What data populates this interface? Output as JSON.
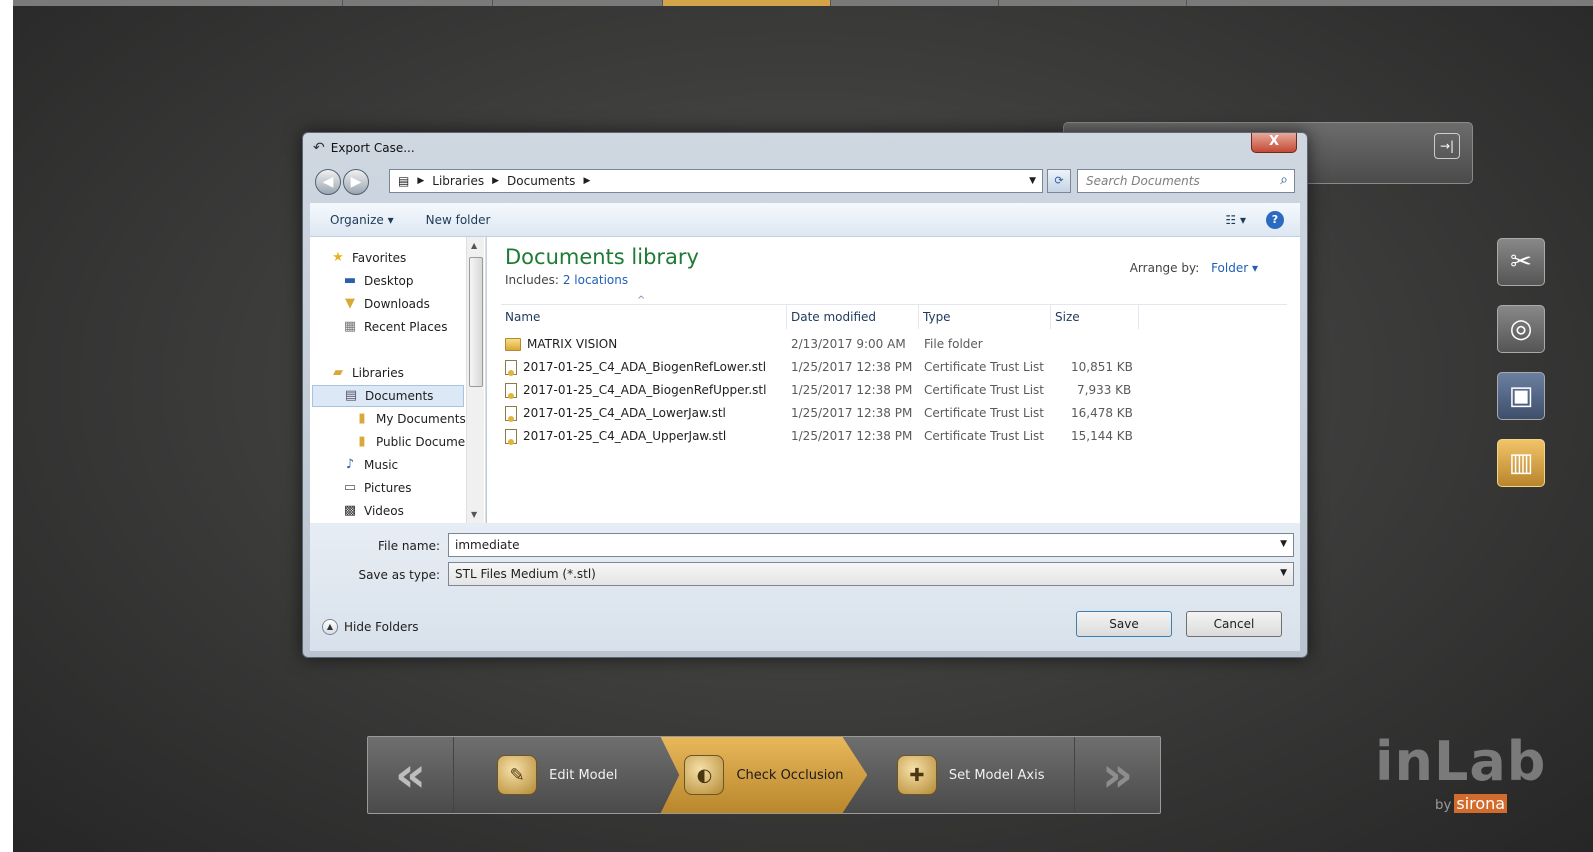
{
  "dialog": {
    "title": "Export Case...",
    "close_label": "X",
    "breadcrumb": [
      "Libraries",
      "Documents"
    ],
    "search_placeholder": "Search Documents",
    "toolbar": {
      "organize": "Organize ▾",
      "new_folder": "New folder"
    },
    "nav": {
      "favorites": "Favorites",
      "desktop": "Desktop",
      "downloads": "Downloads",
      "recent_places": "Recent Places",
      "libraries": "Libraries",
      "documents": "Documents",
      "my_documents": "My Documents",
      "public_documents": "Public Docume",
      "music": "Music",
      "pictures": "Pictures",
      "videos": "Videos"
    },
    "library": {
      "title": "Documents library",
      "includes_label": "Includes:",
      "includes_link": "2 locations",
      "arrange_label": "Arrange by:",
      "arrange_value": "Folder ▾"
    },
    "columns": {
      "name": "Name",
      "date": "Date modified",
      "type": "Type",
      "size": "Size"
    },
    "files": [
      {
        "name": "MATRIX VISION",
        "date": "2/13/2017 9:00 AM",
        "type": "File folder",
        "size": ""
      },
      {
        "name": "2017-01-25_C4_ADA_BiogenRefLower.stl",
        "date": "1/25/2017 12:38 PM",
        "type": "Certificate Trust List",
        "size": "10,851 KB"
      },
      {
        "name": "2017-01-25_C4_ADA_BiogenRefUpper.stl",
        "date": "1/25/2017 12:38 PM",
        "type": "Certificate Trust List",
        "size": "7,933 KB"
      },
      {
        "name": "2017-01-25_C4_ADA_LowerJaw.stl",
        "date": "1/25/2017 12:38 PM",
        "type": "Certificate Trust List",
        "size": "16,478 KB"
      },
      {
        "name": "2017-01-25_C4_ADA_UpperJaw.stl",
        "date": "1/25/2017 12:38 PM",
        "type": "Certificate Trust List",
        "size": "15,144 KB"
      }
    ],
    "filename_label": "File name:",
    "filename_value": "immediate",
    "savetype_label": "Save as type:",
    "savetype_value": "STL Files Medium (*.stl)",
    "hide_folders": "Hide Folders",
    "save": "Save",
    "cancel": "Cancel"
  },
  "workflow": {
    "steps": [
      "Edit Model",
      "Check Occlusion",
      "Set Model Axis"
    ],
    "active_step": "Check Occlusion"
  },
  "brand": {
    "name": "inLab",
    "by": "by",
    "company": "sirona"
  },
  "colors": {
    "accent": "#d4a44a",
    "library_title": "#1e7b34",
    "link": "#1f5fb9"
  }
}
